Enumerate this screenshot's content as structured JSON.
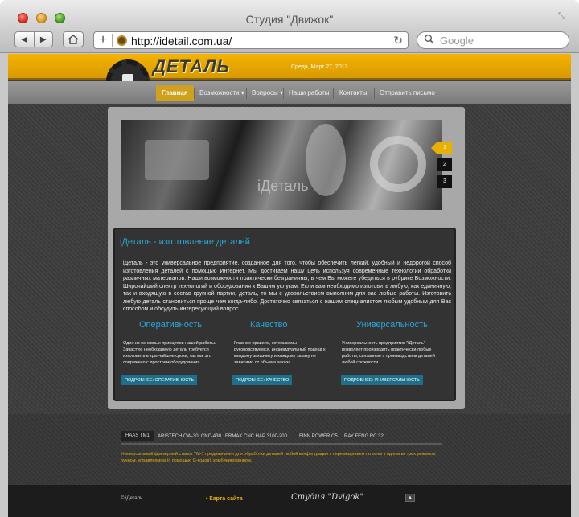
{
  "browser": {
    "window_title": "Студия \"Движок\"",
    "url": "http://idetail.com.ua/",
    "search_placeholder": "Google",
    "back_glyph": "◀",
    "forward_glyph": "▶",
    "plus_glyph": "+",
    "reload_glyph": "↻",
    "resize_glyph": "⤡",
    "search_glyph": "🔍"
  },
  "site": {
    "logo_text": "ДЕТАЛЬ",
    "date": "Среда, Март 27, 2013",
    "nav": [
      {
        "label": "Главная",
        "active": true
      },
      {
        "label": "Возможности ▾"
      },
      {
        "label": "Вопросы ▾"
      },
      {
        "label": "Наши работы"
      },
      {
        "label": "Контакты"
      },
      {
        "label": "Отправить письмо"
      }
    ],
    "slider": {
      "caption": "iДеталь",
      "buttons": [
        "1",
        "2",
        "3"
      ],
      "active": "1"
    },
    "content": {
      "title": "iДеталь - изготовление деталей",
      "text": "iДеталь - это универсальное предприятие, созданное для того, чтобы обеспечить легкий, удобный и недорогой способ изготовления деталей с помощью Интернет. Мы достигаем нашу цель используя современные технологии обработки различных материалов. Наши возможности практически безграничны, в чем Вы можете убедиться в рубрике Возможности. Широчайший спектр технологий и оборудования к Вашим услугам. Если вам необходимо изготовить любую, как единичную, так и входящую в состав крупной партии, деталь, то мы с удовольствием выполним для вас любые работы. Изготовить любую деталь становиться проще чем когда-либо. Достаточно связаться с нашим специалистом любым удобным для Вас способом и обсудить интересующий вопрос.",
      "features": [
        {
          "title": "Оперативность",
          "text": "Один из основных принципов нашей работы. Зачастую необходимую деталь требуется изготовить в кратчайшие сроки, так как это сопряжено с простоем оборудования.",
          "button": "ПОДРОБНЕЕ: ОПЕРАТИВНОСТЬ"
        },
        {
          "title": "Качество",
          "text": "Главное правило, которым мы руководствуемся, индивидуальный подход к каждому заказчику и каждому заказу не зависимо от объема заказа.",
          "button": "ПОДРОБНЕЕ: КАЧЕСТВО"
        },
        {
          "title": "Универсальность",
          "text": "Универсальность предприятия \"iДеталь\" позволяет производить практически любые работы, связанные с производством деталей любой сложности.",
          "button": "ПОДРОБНЕЕ: УНИВЕРСАЛЬНОСТЬ"
        }
      ]
    },
    "machine_tabs": [
      "HAAS TM1",
      "ARISTECH CW-30, CNC-430",
      "ERMAK CNC HAP 3100-200",
      "FINN POWER C5",
      "RAY FENG RC 32"
    ],
    "promo_text": "Универсальный фрезерный станок ТМ-1 предназначен для обработки деталей любой конфигурации с перемещением по осям в одном из трех режимов: ручном, управляемом (с помощью G-кодов), комбинированном.",
    "footer": {
      "copyright": "© iДеталь",
      "sitemap": "Карта сайта",
      "studio": "Студия \"Dvigok\"",
      "up_glyph": "▲"
    }
  },
  "colors": {
    "accent": "#e8b100",
    "link_blue": "#2aa8d8",
    "button_blue": "#1e6f8a"
  }
}
